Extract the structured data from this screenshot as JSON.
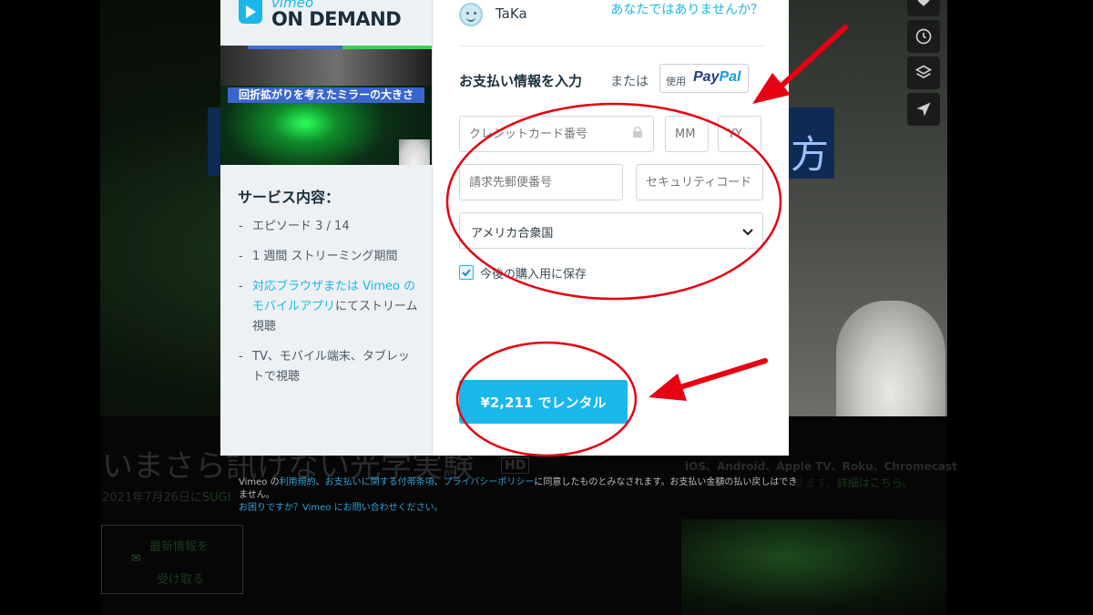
{
  "colors": {
    "accent": "#1ab7ea",
    "annotation": "#e60012",
    "modal_bg": "#ffffff",
    "sidebar_bg": "#eef1f4"
  },
  "background": {
    "title": "いまさら訊けない光学実験",
    "hd": "HD",
    "date_prefix": "2021年7月26日に",
    "date_link": "SUGI",
    "notify_line1": "最新情報を",
    "notify_line2": "受け取る",
    "platforms": "iOS、Android、Apple TV、Roku、Chromecast",
    "platforms_line2_prefix": "きます。",
    "platforms_link": "詳細はこちら。",
    "hero_char": "方",
    "side_icons": [
      "heart-icon",
      "clock-icon",
      "layers-icon",
      "send-icon"
    ]
  },
  "modal": {
    "logo_small": "vimeo",
    "logo_big": "ON DEMAND",
    "promo_caption": "回折拡がりを考えたミラーの大きさ",
    "service_title": "サービス内容：",
    "service_items": [
      {
        "text": "エピソード 3 / 14"
      },
      {
        "text": "1 週間 ストリーミング期間"
      },
      {
        "link": "対応ブラウザまたは Vimeo のモバイルアプリ",
        "text": "にてストリーム視聴"
      },
      {
        "text": "TV、モバイル端末、タブレットで視聴"
      }
    ],
    "user": {
      "name": "TaKa",
      "not_you": "あなたではありませんか？"
    },
    "payment": {
      "heading": "お支払い情報を入力",
      "or": "または",
      "paypal_use": "使用",
      "paypal_pay": "Pay",
      "paypal_pal": "Pal",
      "card_placeholder": "クレジットカード番号",
      "mm_placeholder": "MM",
      "yy_placeholder": "YY",
      "zip_placeholder": "請求先郵便番号",
      "cvc_placeholder": "セキュリティコード",
      "country": "アメリカ合衆国",
      "save_label": "今後の購入用に保存",
      "save_checked": true
    },
    "rent_button": "¥2,211 でレンタル"
  },
  "legal": {
    "p1": "Vimeo の",
    "link_terms": "利用規約",
    "sep1": "、",
    "link_payment_terms": "お支払いに関する付帯条項",
    "sep2": "、",
    "link_privacy": "プライバシーポリシー",
    "p2": "に同意したものとみなされます。お支払い金額の払い戻しはできません。",
    "help_link": "お困りですか？Vimeo にお問い合わせください。"
  }
}
